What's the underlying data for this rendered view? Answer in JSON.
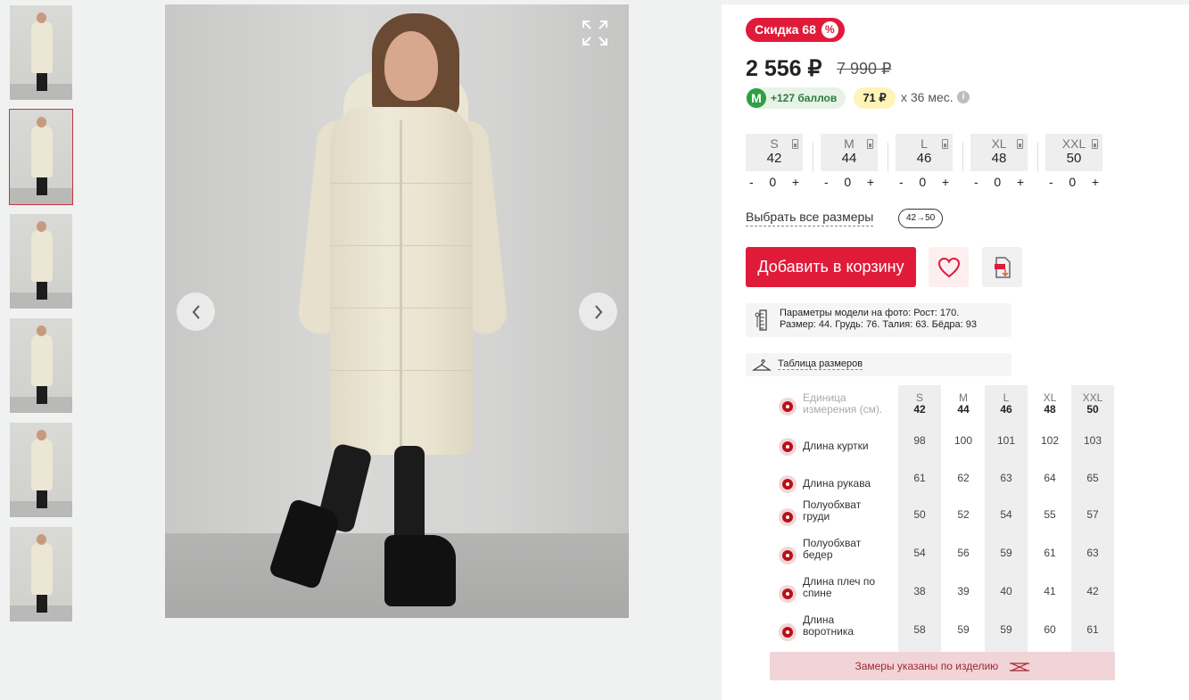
{
  "gallery": {
    "thumbnails": [
      {
        "label": "photo-1",
        "active": false
      },
      {
        "label": "photo-2",
        "active": true
      },
      {
        "label": "photo-3",
        "active": false
      },
      {
        "label": "photo-4",
        "active": false
      },
      {
        "label": "photo-5",
        "active": false
      },
      {
        "label": "photo-6",
        "active": false
      }
    ],
    "icons": {
      "expand": "expand-icon",
      "prev": "chevron-left-icon",
      "next": "chevron-right-icon"
    }
  },
  "product": {
    "discount_label": "Скидка 68",
    "discount_icon": "%",
    "price": "2 556 ₽",
    "old_price": "7 990 ₽",
    "bonus_letter": "М",
    "bonus_text": "+127 баллов",
    "installment_amount": "71 ₽",
    "installment_term": "х 36 мес.",
    "info_icon": "i"
  },
  "sizes": [
    {
      "label": "S",
      "number": "42",
      "qty": "0"
    },
    {
      "label": "M",
      "number": "44",
      "qty": "0"
    },
    {
      "label": "L",
      "number": "46",
      "qty": "0"
    },
    {
      "label": "XL",
      "number": "48",
      "qty": "0"
    },
    {
      "label": "XXL",
      "number": "50",
      "qty": "0"
    }
  ],
  "stepper": {
    "minus": "-",
    "plus": "+"
  },
  "select_all_label": "Выбрать все размеры",
  "size_range": "42→50",
  "actions": {
    "add_to_cart": "Добавить в корзину",
    "favorite_icon": "heart-icon",
    "download_icon": "pdf-download-icon"
  },
  "model_params": {
    "line1": "Параметры модели на фото: Рост: 170.",
    "line2": "Размер: 44. Грудь: 76. Талия: 63. Бёдра: 93"
  },
  "size_table_link": "Таблица размеров",
  "measure_table": {
    "unit_label": [
      "Единица",
      "измерения (см)."
    ],
    "columns": [
      {
        "label": "S",
        "number": "42"
      },
      {
        "label": "M",
        "number": "44"
      },
      {
        "label": "L",
        "number": "46"
      },
      {
        "label": "XL",
        "number": "48"
      },
      {
        "label": "XXL",
        "number": "50"
      }
    ],
    "rows": [
      {
        "name": [
          "Длина куртки"
        ],
        "values": [
          "98",
          "100",
          "101",
          "102",
          "103"
        ]
      },
      {
        "name": [
          "Длина рукава"
        ],
        "values": [
          "61",
          "62",
          "63",
          "64",
          "65"
        ]
      },
      {
        "name": [
          "Полуобхват",
          "груди"
        ],
        "values": [
          "50",
          "52",
          "54",
          "55",
          "57"
        ]
      },
      {
        "name": [
          "Полуобхват",
          "бедер"
        ],
        "values": [
          "54",
          "56",
          "59",
          "61",
          "63"
        ]
      },
      {
        "name": [
          "Длина плеч по",
          "спине"
        ],
        "values": [
          "38",
          "39",
          "40",
          "41",
          "42"
        ]
      },
      {
        "name": [
          "Длина",
          "воротника"
        ],
        "values": [
          "58",
          "59",
          "59",
          "60",
          "61"
        ]
      }
    ]
  },
  "note": "Замеры указаны по изделию",
  "colors": {
    "accent": "#e01b3a",
    "bonus_green": "#2ea043",
    "installment_yellow": "#fff3b8"
  }
}
